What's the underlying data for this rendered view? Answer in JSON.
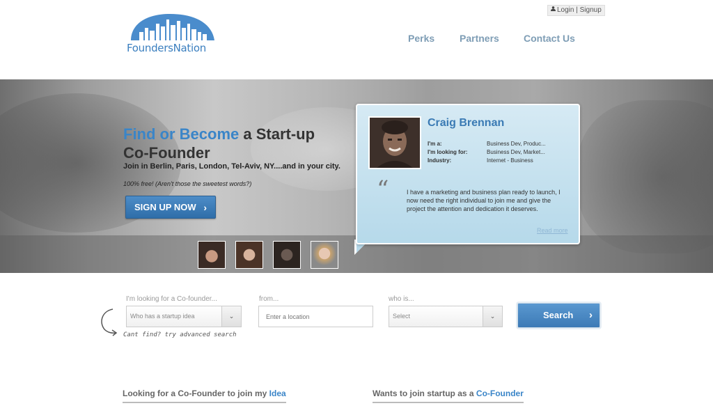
{
  "header": {
    "logo_text": "FoundersNation",
    "login_label": "Login | Signup",
    "nav": [
      {
        "label": "Perks"
      },
      {
        "label": "Partners"
      },
      {
        "label": "Contact Us"
      }
    ]
  },
  "hero": {
    "headline_blue": "Find or Become",
    "headline_rest": " a Start-up",
    "headline_line2": "Co-Founder",
    "subtitle": "Join in Berlin, Paris, London, Tel-Aviv, NY....and in your city.",
    "free_note": "100% free! (Aren't those the sweetest words?)",
    "signup_label": "SIGN UP NOW"
  },
  "profile_card": {
    "name": "Craig Brennan",
    "rows": [
      {
        "key": "I'm a:",
        "value": "Business Dev, Produc..."
      },
      {
        "key": "I'm looking for:",
        "value": "Business Dev, Market..."
      },
      {
        "key": "Industry:",
        "value": "Internet - Business"
      }
    ],
    "quote": "I have a marketing and business plan ready to launch, I now need the right individual to join me and give the project the attention and dedication it deserves.",
    "read_more": "Read more"
  },
  "search": {
    "looking_label": "I'm looking for a Co-founder...",
    "looking_value": "Who has a startup idea",
    "from_label": "from...",
    "location_placeholder": "Enter a location",
    "who_label": "who is...",
    "who_value": "Select",
    "button_label": "Search",
    "advanced_link": "Cant find? try advanced search"
  },
  "sections": {
    "left_prefix": "Looking for a Co-Founder to join my ",
    "left_highlight": "Idea",
    "right_prefix": "Wants to join startup as a ",
    "right_highlight": "Co-Founder"
  },
  "colors": {
    "brand_blue": "#3a85c8",
    "nav_gray_blue": "#7e9db5",
    "button_blue": "#3c7ab6"
  }
}
